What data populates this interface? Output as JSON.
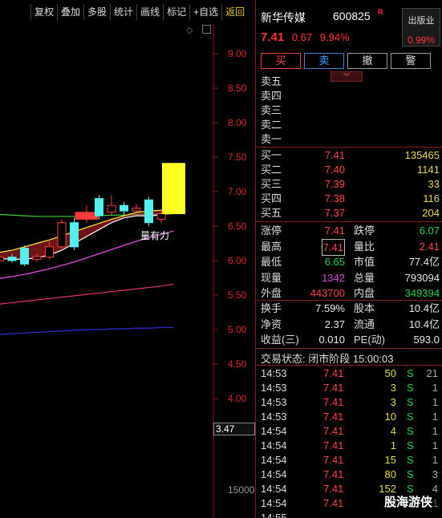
{
  "toolbar": {
    "buttons": [
      "复权",
      "叠加",
      "多股",
      "统计",
      "画线",
      "标记",
      "+自选",
      "返回"
    ]
  },
  "chart": {
    "y_labels": [
      "9.00",
      "8.50",
      "8.00",
      "7.50",
      "7.00",
      "6.50",
      "6.00",
      "5.50",
      "5.00",
      "4.50",
      "4.00"
    ],
    "volume_label": "15000",
    "cursor_value": "3.47",
    "annotation": "量有力",
    "colors": {
      "up": "#ff3b3b",
      "down": "#54f0f0",
      "limit_up": "#ffff22",
      "ma_short": "#ffffff",
      "ma_mid": "#ffee33",
      "ma_long": "#ee55ee"
    }
  },
  "chart_data": {
    "type": "candlestick",
    "ylim": [
      3.6,
      9.4
    ],
    "candles": [
      {
        "o": 5.98,
        "c": 6.02,
        "h": 6.05,
        "l": 5.95
      },
      {
        "o": 6.0,
        "c": 6.05,
        "h": 6.08,
        "l": 5.96
      },
      {
        "o": 6.05,
        "c": 6.0,
        "h": 6.1,
        "l": 5.97
      },
      {
        "o": 6.18,
        "c": 5.95,
        "h": 6.22,
        "l": 5.92
      },
      {
        "o": 6.02,
        "c": 6.06,
        "h": 6.1,
        "l": 5.98
      },
      {
        "o": 6.05,
        "c": 6.2,
        "h": 6.28,
        "l": 6.02
      },
      {
        "o": 6.2,
        "c": 6.55,
        "h": 6.6,
        "l": 6.18
      },
      {
        "o": 6.55,
        "c": 6.2,
        "h": 6.62,
        "l": 6.15
      },
      {
        "o": 6.6,
        "c": 6.7,
        "h": 6.8,
        "l": 6.55
      },
      {
        "o": 6.9,
        "c": 6.65,
        "h": 6.95,
        "l": 6.6
      },
      {
        "o": 6.7,
        "c": 6.8,
        "h": 6.95,
        "l": 6.65
      },
      {
        "o": 6.8,
        "c": 6.72,
        "h": 6.85,
        "l": 6.65
      },
      {
        "o": 6.72,
        "c": 6.76,
        "h": 6.82,
        "l": 6.68
      },
      {
        "o": 6.88,
        "c": 6.55,
        "h": 6.92,
        "l": 6.5
      },
      {
        "o": 6.6,
        "c": 6.68,
        "h": 6.75,
        "l": 6.55
      },
      {
        "o": 6.68,
        "c": 7.41,
        "h": 7.41,
        "l": 6.68
      }
    ],
    "ma_short": [
      6.05,
      6.03,
      6.02,
      6.02,
      6.04,
      6.08,
      6.15,
      6.25,
      6.35,
      6.45,
      6.55,
      6.62,
      6.65,
      6.65,
      6.66,
      6.7
    ],
    "ma_mid": [
      6.1,
      6.12,
      6.15,
      6.2,
      6.25,
      6.3,
      6.36,
      6.42,
      6.48,
      6.54,
      6.6,
      6.65,
      6.7,
      6.72,
      6.73,
      6.75
    ],
    "ma_long": [
      5.72,
      5.74,
      5.77,
      5.8,
      5.84,
      5.88,
      5.93,
      5.98,
      6.04,
      6.1,
      6.16,
      6.22,
      6.28,
      6.33,
      6.38,
      6.43
    ],
    "ma_slow": [
      5.35,
      5.37,
      5.39,
      5.41,
      5.43,
      5.45,
      5.47,
      5.49,
      5.51,
      5.53,
      5.55,
      5.57,
      5.59,
      5.61,
      5.63,
      5.66
    ],
    "ma_slowest": [
      4.92,
      4.93,
      4.94,
      4.95,
      4.96,
      4.97,
      4.98,
      4.99,
      5.0,
      5.0,
      5.01,
      5.01,
      5.02,
      5.02,
      5.03,
      5.03
    ],
    "ma_flat": [
      6.68,
      6.67,
      6.66,
      6.65,
      6.64,
      6.64,
      6.64,
      6.64,
      6.64,
      6.65,
      6.66,
      6.66,
      6.67,
      6.67,
      6.67,
      6.68
    ]
  },
  "quote": {
    "name": "新华传媒",
    "code": "600825",
    "badge": "R",
    "price": "7.41",
    "change": "0.67",
    "change_pct": "9.94%",
    "industry": {
      "name": "出版业",
      "pct": "0.99%"
    }
  },
  "trade_buttons": [
    "买",
    "卖",
    "撤",
    "警"
  ],
  "asks": [
    {
      "label": "卖五",
      "price": "",
      "volume": ""
    },
    {
      "label": "卖四",
      "price": "",
      "volume": ""
    },
    {
      "label": "卖三",
      "price": "",
      "volume": ""
    },
    {
      "label": "卖二",
      "price": "",
      "volume": ""
    },
    {
      "label": "卖一",
      "price": "",
      "volume": ""
    }
  ],
  "bids": [
    {
      "label": "买一",
      "price": "7.41",
      "volume": "135465"
    },
    {
      "label": "买二",
      "price": "7.40",
      "volume": "1141"
    },
    {
      "label": "买三",
      "price": "7.39",
      "volume": "33"
    },
    {
      "label": "买四",
      "price": "7.38",
      "volume": "116"
    },
    {
      "label": "买五",
      "price": "7.37",
      "volume": "204"
    }
  ],
  "stats1": [
    {
      "l1": "涨停",
      "v1": "7.41",
      "c1": "red",
      "l2": "跌停",
      "v2": "6.07",
      "c2": "green"
    },
    {
      "l1": "最高",
      "v1": "7.41",
      "c1": "red",
      "l2": "量比",
      "v2": "2.41",
      "c2": "red"
    },
    {
      "l1": "最低",
      "v1": "6.65",
      "c1": "green",
      "l2": "市值",
      "v2": "77.4亿",
      "c2": "white"
    },
    {
      "l1": "现量",
      "v1": "1342",
      "c1": "purple",
      "l2": "总量",
      "v2": "793094",
      "c2": "white"
    },
    {
      "l1": "外盘",
      "v1": "443700",
      "c1": "red",
      "l2": "内盘",
      "v2": "349394",
      "c2": "green"
    }
  ],
  "stats2": [
    {
      "l1": "换手",
      "v1": "7.59%",
      "c1": "white",
      "l2": "股本",
      "v2": "10.4亿",
      "c2": "white"
    },
    {
      "l1": "净资",
      "v1": "2.37",
      "c1": "white",
      "l2": "流通",
      "v2": "10.4亿",
      "c2": "white"
    },
    {
      "l1": "收益(三)",
      "v1": "0.010",
      "c1": "white",
      "l2": "PE(动)",
      "v2": "593.0",
      "c2": "white"
    }
  ],
  "trade_status": "交易状态: 闭市阶段 15:00:03",
  "ticks": [
    {
      "time": "14:53",
      "price": "7.41",
      "vol": "50",
      "side": "S",
      "n": "21"
    },
    {
      "time": "14:53",
      "price": "7.41",
      "vol": "3",
      "side": "S",
      "n": "1"
    },
    {
      "time": "14:53",
      "price": "7.41",
      "vol": "3",
      "side": "S",
      "n": "1"
    },
    {
      "time": "14:53",
      "price": "7.41",
      "vol": "10",
      "side": "S",
      "n": "1"
    },
    {
      "time": "14:54",
      "price": "7.41",
      "vol": "4",
      "side": "S",
      "n": "1"
    },
    {
      "time": "14:54",
      "price": "7.41",
      "vol": "1",
      "side": "S",
      "n": "1"
    },
    {
      "time": "14:54",
      "price": "7.41",
      "vol": "15",
      "side": "S",
      "n": "1"
    },
    {
      "time": "14:54",
      "price": "7.41",
      "vol": "80",
      "side": "S",
      "n": "3"
    },
    {
      "time": "14:54",
      "price": "7.41",
      "vol": "152",
      "side": "S",
      "n": "4"
    },
    {
      "time": "14:54",
      "price": "7.41",
      "vol": "5",
      "side": "S",
      "n": "1"
    },
    {
      "time": "14:55",
      "price": "",
      "vol": "",
      "side": "",
      "n": ""
    }
  ],
  "watermark": "股海游侠"
}
